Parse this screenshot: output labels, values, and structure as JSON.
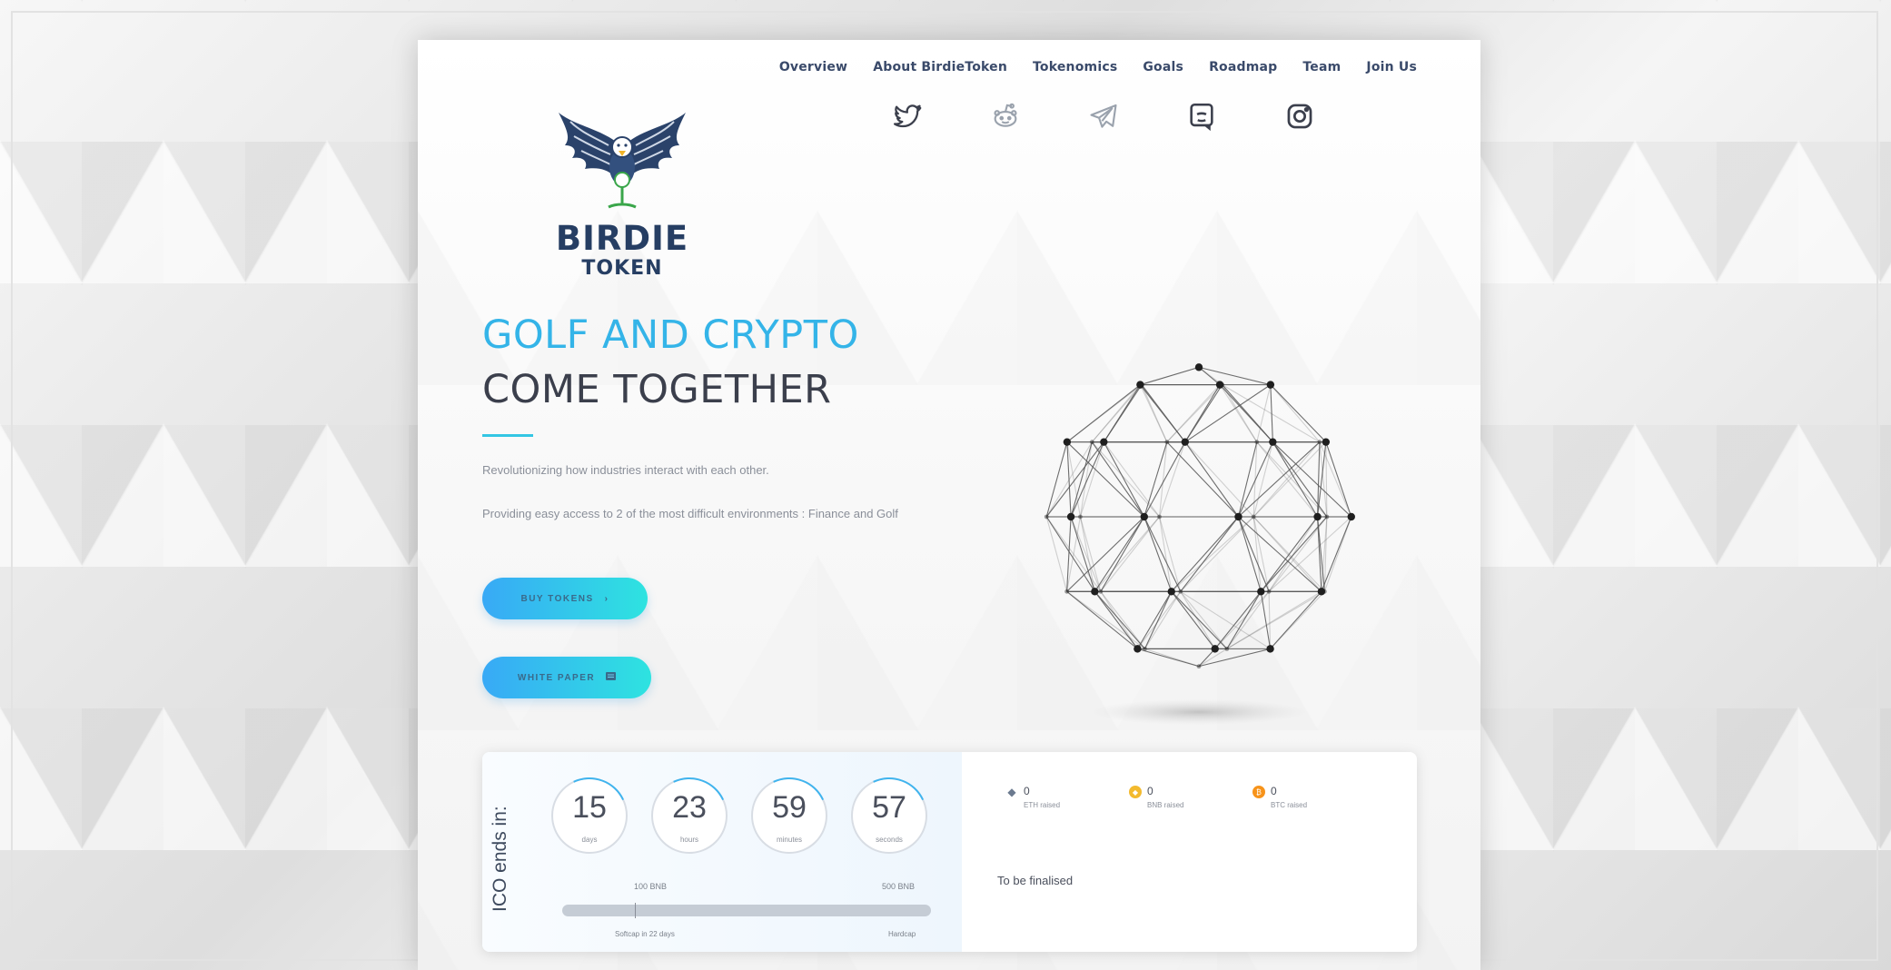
{
  "nav": {
    "items": [
      "Overview",
      "About BirdieToken",
      "Tokenomics",
      "Goals",
      "Roadmap",
      "Team",
      "Join Us"
    ]
  },
  "social": {
    "icons": [
      "twitter-icon",
      "reddit-icon",
      "telegram-icon",
      "discord-icon",
      "instagram-icon"
    ]
  },
  "logo": {
    "line1": "BIRDIE",
    "line2": "TOKEN"
  },
  "hero": {
    "title_line1": "GOLF AND CRYPTO",
    "title_line2": "COME TOGETHER",
    "paragraph1": "Revolutionizing how industries interact with each other.",
    "paragraph2": "Providing easy access to 2 of the most difficult environments : Finance and Golf",
    "buy_button": "BUY TOKENS",
    "white_paper_button": "WHITE PAPER"
  },
  "ico": {
    "label": "ICO ends in:",
    "countdown": [
      {
        "value": "15",
        "unit": "days"
      },
      {
        "value": "23",
        "unit": "hours"
      },
      {
        "value": "59",
        "unit": "minutes"
      },
      {
        "value": "57",
        "unit": "seconds"
      }
    ],
    "softcap_amount": "100 BNB",
    "hardcap_amount": "500 BNB",
    "progress_fraction": 0.0,
    "softcap_label": "Softcap in 22 days",
    "hardcap_label": "Hardcap"
  },
  "raised": [
    {
      "value": "0",
      "label": "ETH raised",
      "icon": "eth-icon",
      "color": "#6b7a8f"
    },
    {
      "value": "0",
      "label": "BNB raised",
      "icon": "bnb-icon",
      "color": "#f3ba2f"
    },
    {
      "value": "0",
      "label": "BTC raised",
      "icon": "btc-icon",
      "color": "#f7931a"
    }
  ],
  "status": "To be finalised",
  "colors": {
    "accent": "#34b4e8",
    "heading_dark": "#3b3f4c",
    "logo_navy": "#263e63"
  }
}
